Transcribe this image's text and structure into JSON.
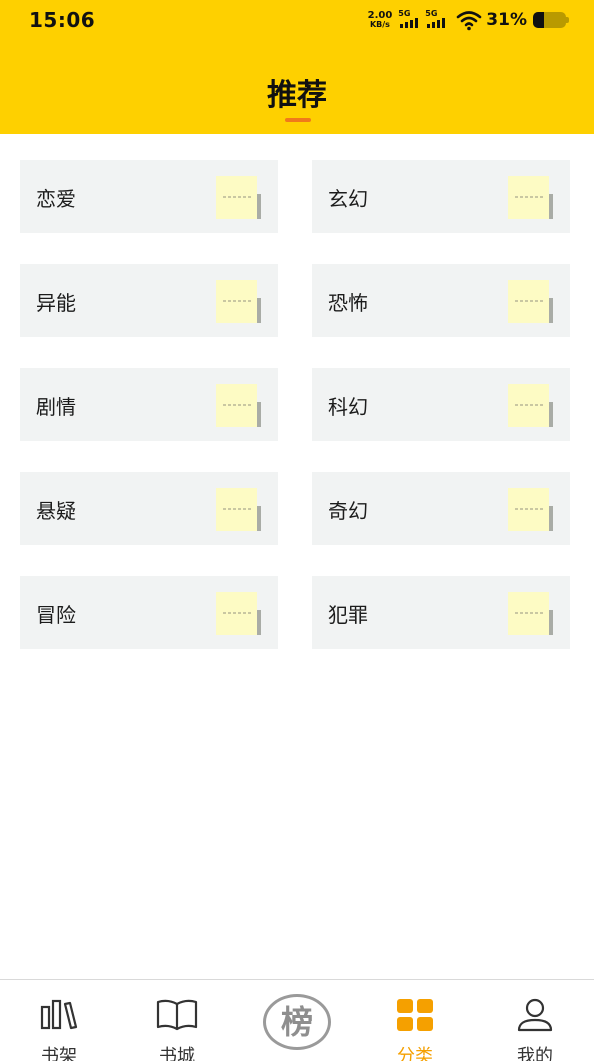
{
  "status_bar": {
    "time": "15:06",
    "net_speed_value": "2.00",
    "net_speed_unit": "KB/s",
    "signal_1_label": "5G",
    "signal_2_label": "5G",
    "battery_percent": "31%"
  },
  "header": {
    "title": "推荐",
    "background_color": "#fed000",
    "underline_color": "#f07a1a"
  },
  "categories": [
    {
      "label": "恋爱"
    },
    {
      "label": "玄幻"
    },
    {
      "label": "异能"
    },
    {
      "label": "恐怖"
    },
    {
      "label": "剧情"
    },
    {
      "label": "科幻"
    },
    {
      "label": "悬疑"
    },
    {
      "label": "奇幻"
    },
    {
      "label": "冒险"
    },
    {
      "label": "犯罪"
    }
  ],
  "bottom_nav": {
    "items": [
      {
        "label": "书架",
        "icon": "bookshelf-icon",
        "active": false
      },
      {
        "label": "书城",
        "icon": "open-book-icon",
        "active": false
      },
      {
        "label": "分类",
        "icon": "category-grid-icon",
        "active": true
      },
      {
        "label": "我的",
        "icon": "user-icon",
        "active": false
      }
    ],
    "rank_badge": "榜",
    "active_color": "#f5a000"
  }
}
